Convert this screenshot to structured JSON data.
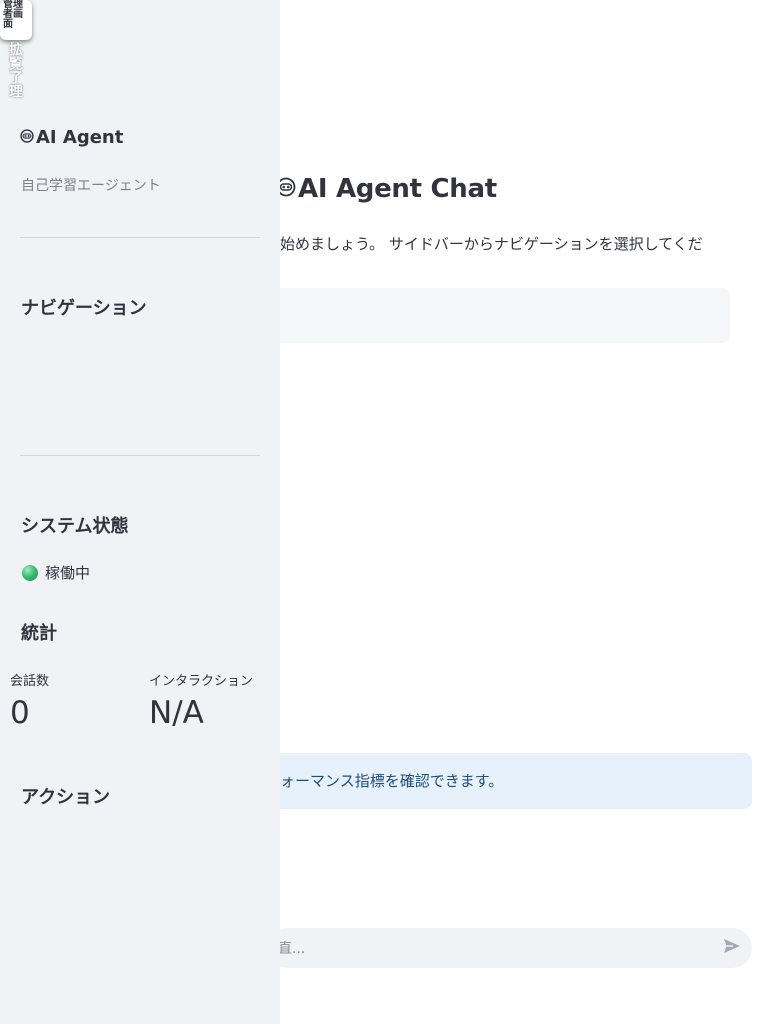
{
  "main": {
    "title": "AI Agent Chat",
    "title_icon": "robot-face-icon",
    "description": "始めましょう。 サイドバーからナビゲーションを選択してくだ",
    "info_text": "ォーマンス指標を確認できます。",
    "chat_input": {
      "placeholder": "直...",
      "send_icon": "send-arrow-icon"
    }
  },
  "sidebar": {
    "collapse_button_text": "管理者画面",
    "vertical_text": "拡覧了理",
    "brand": {
      "icon": "robot-face-icon",
      "name": "AI Agent"
    },
    "subtitle": "自己学習エージェント",
    "navigation_heading": "ナビゲーション",
    "system_status": {
      "heading": "システム状態",
      "status_text": "稼働中",
      "status_color": "#3dbd72"
    },
    "stats": {
      "heading": "統計",
      "metrics": [
        {
          "label": "会話数",
          "value": "0"
        },
        {
          "label": "インタラクション",
          "value": "N/A"
        }
      ]
    },
    "actions_heading": "アクション"
  },
  "colors": {
    "sidebar_bg": "#f0f2f6",
    "info_bg": "#e7f1fb",
    "info_text": "#1f4e79",
    "text": "#31333f"
  }
}
